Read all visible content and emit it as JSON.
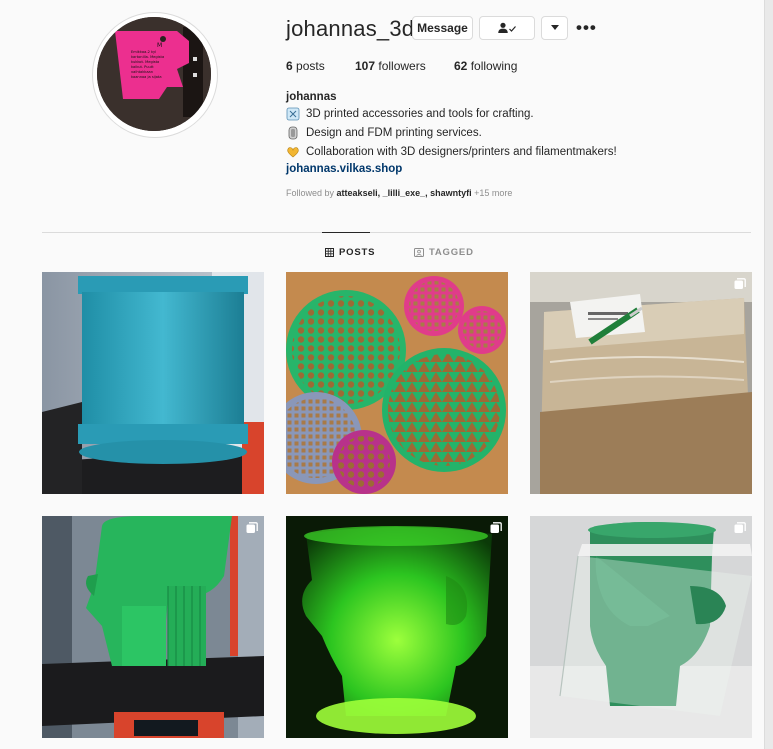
{
  "profile": {
    "username": "johannas_3d",
    "message_label": "Message",
    "more_label": "•••",
    "posts_count": "6",
    "posts_label": "posts",
    "followers_count": "107",
    "followers_label": "followers",
    "following_count": "62",
    "following_label": "following",
    "full_name": "johannas",
    "bio": [
      "3D printed accessories and tools for crafting.",
      "Design and FDM printing services.",
      "Collaboration with 3D designers/printers and filamentmakers!"
    ],
    "website": "johannas.vilkas.shop",
    "followed_by_prefix": "Followed by",
    "followed_by_names": "atteakseli, _lilli_exe_, shawntyfi",
    "followed_by_more": "+15 more"
  },
  "tabs": {
    "posts": "POSTS",
    "tagged": "TAGGED"
  },
  "avatar_tag_text": [
    "M",
    "Emikkaa-2 kyl",
    "kartonilla. Megista",
    "kukkot. Megista",
    "kaikut. Puutt",
    "vaihtakkaan",
    "kaannoa ja sijata"
  ],
  "colors": {
    "link": "#00376b",
    "muted": "#8e8e8e",
    "divider": "#dbdbdb",
    "avatar_tag": "#ec2f8f"
  },
  "icons": {
    "bio_1": "spool-icon",
    "bio_2": "filament-icon",
    "bio_3": "heart-hands-icon",
    "follow": "person-check-icon",
    "dropdown": "caret-down-icon",
    "posts_tab": "grid-icon",
    "tagged_tab": "tag-icon",
    "multi": "carousel-icon"
  }
}
